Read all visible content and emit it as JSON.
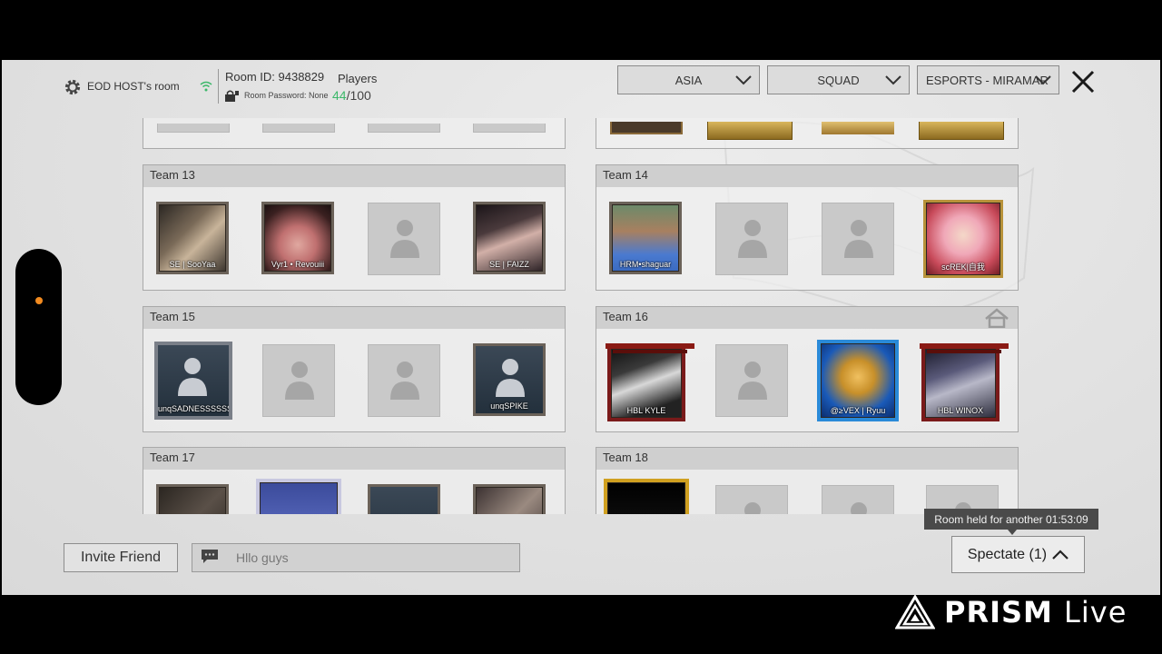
{
  "header": {
    "host_name": "EOD HOST's room",
    "room_id": "Room ID: 9438829",
    "room_password": "Room Password: None",
    "players_label": "Players",
    "players_current": "44",
    "players_max": "/100"
  },
  "filters": {
    "region": "ASIA",
    "mode": "SQUAD",
    "map": "ESPORTS - MIRAMAR"
  },
  "teams": [
    {
      "name": "Team 13",
      "slots": [
        "SE | SooYaa",
        "Vyr1 • Revouiii",
        "",
        "SE | FAIZZ"
      ]
    },
    {
      "name": "Team 14",
      "slots": [
        "HRM•shaguar",
        "",
        "",
        "scREK|自我"
      ]
    },
    {
      "name": "Team 15",
      "slots": [
        "unqSADNESSSSSS",
        "",
        "",
        "unqSPIKE"
      ]
    },
    {
      "name": "Team 16",
      "slots": [
        "HBL KYLE",
        "",
        "@≥VEX | Ryuu",
        "HBL WINOX"
      ]
    },
    {
      "name": "Team 17",
      "slots": [
        "",
        "",
        "",
        ""
      ]
    },
    {
      "name": "Team 18",
      "slots": [
        "",
        "",
        "",
        ""
      ]
    }
  ],
  "bottom": {
    "invite_label": "Invite Friend",
    "chat_text": "Hllo guys",
    "room_held": "Room held for another 01:53:09",
    "spectate_label": "Spectate (1)"
  },
  "watermark": {
    "brand": "PRISM",
    "suffix": "Live"
  },
  "colors": {
    "players_current": "#3cb86a",
    "side_dot": "#f28b20"
  }
}
